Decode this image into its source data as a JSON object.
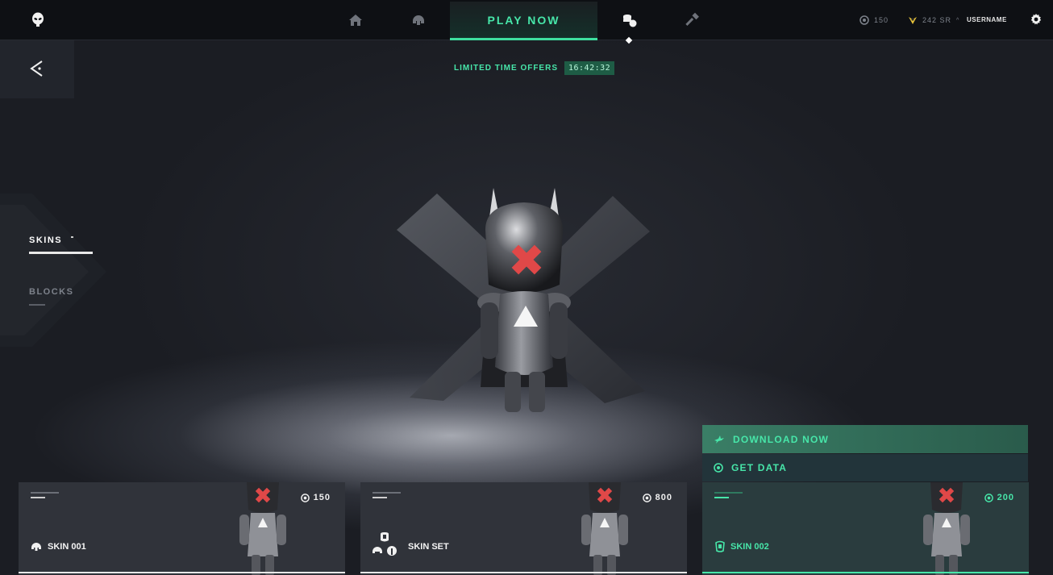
{
  "topbar": {
    "play_now": "PLAY NOW",
    "currency_value": "150",
    "rank_value": "242 SR",
    "username": "USERNAME"
  },
  "offers": {
    "label": "LIMITED TIME OFFERS",
    "timer": "16:42:32"
  },
  "side_menu": {
    "items": [
      {
        "label": "SKINS",
        "active": true
      },
      {
        "label": "BLOCKS",
        "active": false
      }
    ]
  },
  "actions": {
    "download": "DOWNLOAD NOW",
    "get_data": "GET DATA"
  },
  "cards": [
    {
      "name": "SKIN 001",
      "price": "150",
      "selected": false
    },
    {
      "name": "SKIN SET",
      "price": "800",
      "selected": false
    },
    {
      "name": "SKIN 002",
      "price": "200",
      "selected": true
    }
  ],
  "colors": {
    "accent": "#47e6a9",
    "background": "#1b1d23",
    "topbar": "#0e1014",
    "card": "#30333a",
    "mark_red": "#e04848"
  },
  "icons": [
    "alien-logo-icon",
    "home-icon",
    "helmet-icon",
    "coins-icon",
    "hammer-icon",
    "coin-icon",
    "rank-icon",
    "gear-icon",
    "back-arrow-icon",
    "bird-icon",
    "target-icon",
    "mask-icon"
  ]
}
